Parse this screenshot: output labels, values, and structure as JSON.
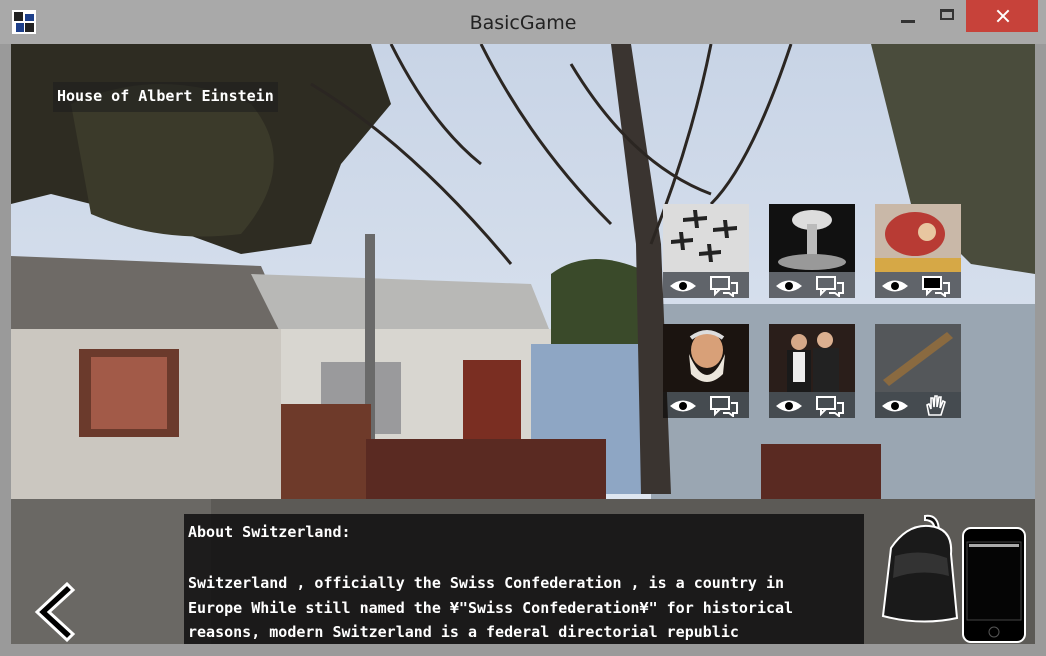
{
  "window": {
    "title": "BasicGame",
    "icon": "app-icon",
    "controls": [
      "minimize",
      "maximize",
      "close"
    ]
  },
  "scene": {
    "location": "House of Albert Einstein"
  },
  "inventory": [
    {
      "id": "bombers",
      "image": "bomber-planes-image",
      "actions": [
        "look",
        "talk"
      ]
    },
    {
      "id": "explosion",
      "image": "mushroom-cloud-image",
      "actions": [
        "look",
        "talk"
      ]
    },
    {
      "id": "painting",
      "image": "painting-image",
      "actions": [
        "look",
        "talk"
      ]
    },
    {
      "id": "galileo",
      "image": "bearded-portrait-image",
      "actions": [
        "look",
        "talk"
      ]
    },
    {
      "id": "couple",
      "image": "two-people-photo-image",
      "actions": [
        "look",
        "talk"
      ]
    },
    {
      "id": "stick",
      "image": "wooden-stick-image",
      "actions": [
        "look",
        "grab"
      ]
    }
  ],
  "info": {
    "title": "About Switzerland:",
    "body": "Switzerland , officially the Swiss Confederation , is a country in\nEurope While still named the ¥\"Swiss Confederation¥\" for historical\nreasons, modern Switzerland is a federal directorial republic"
  },
  "icons": {
    "back": "chevron-left-icon",
    "backpack": "backpack-icon",
    "phone": "phone-icon"
  }
}
